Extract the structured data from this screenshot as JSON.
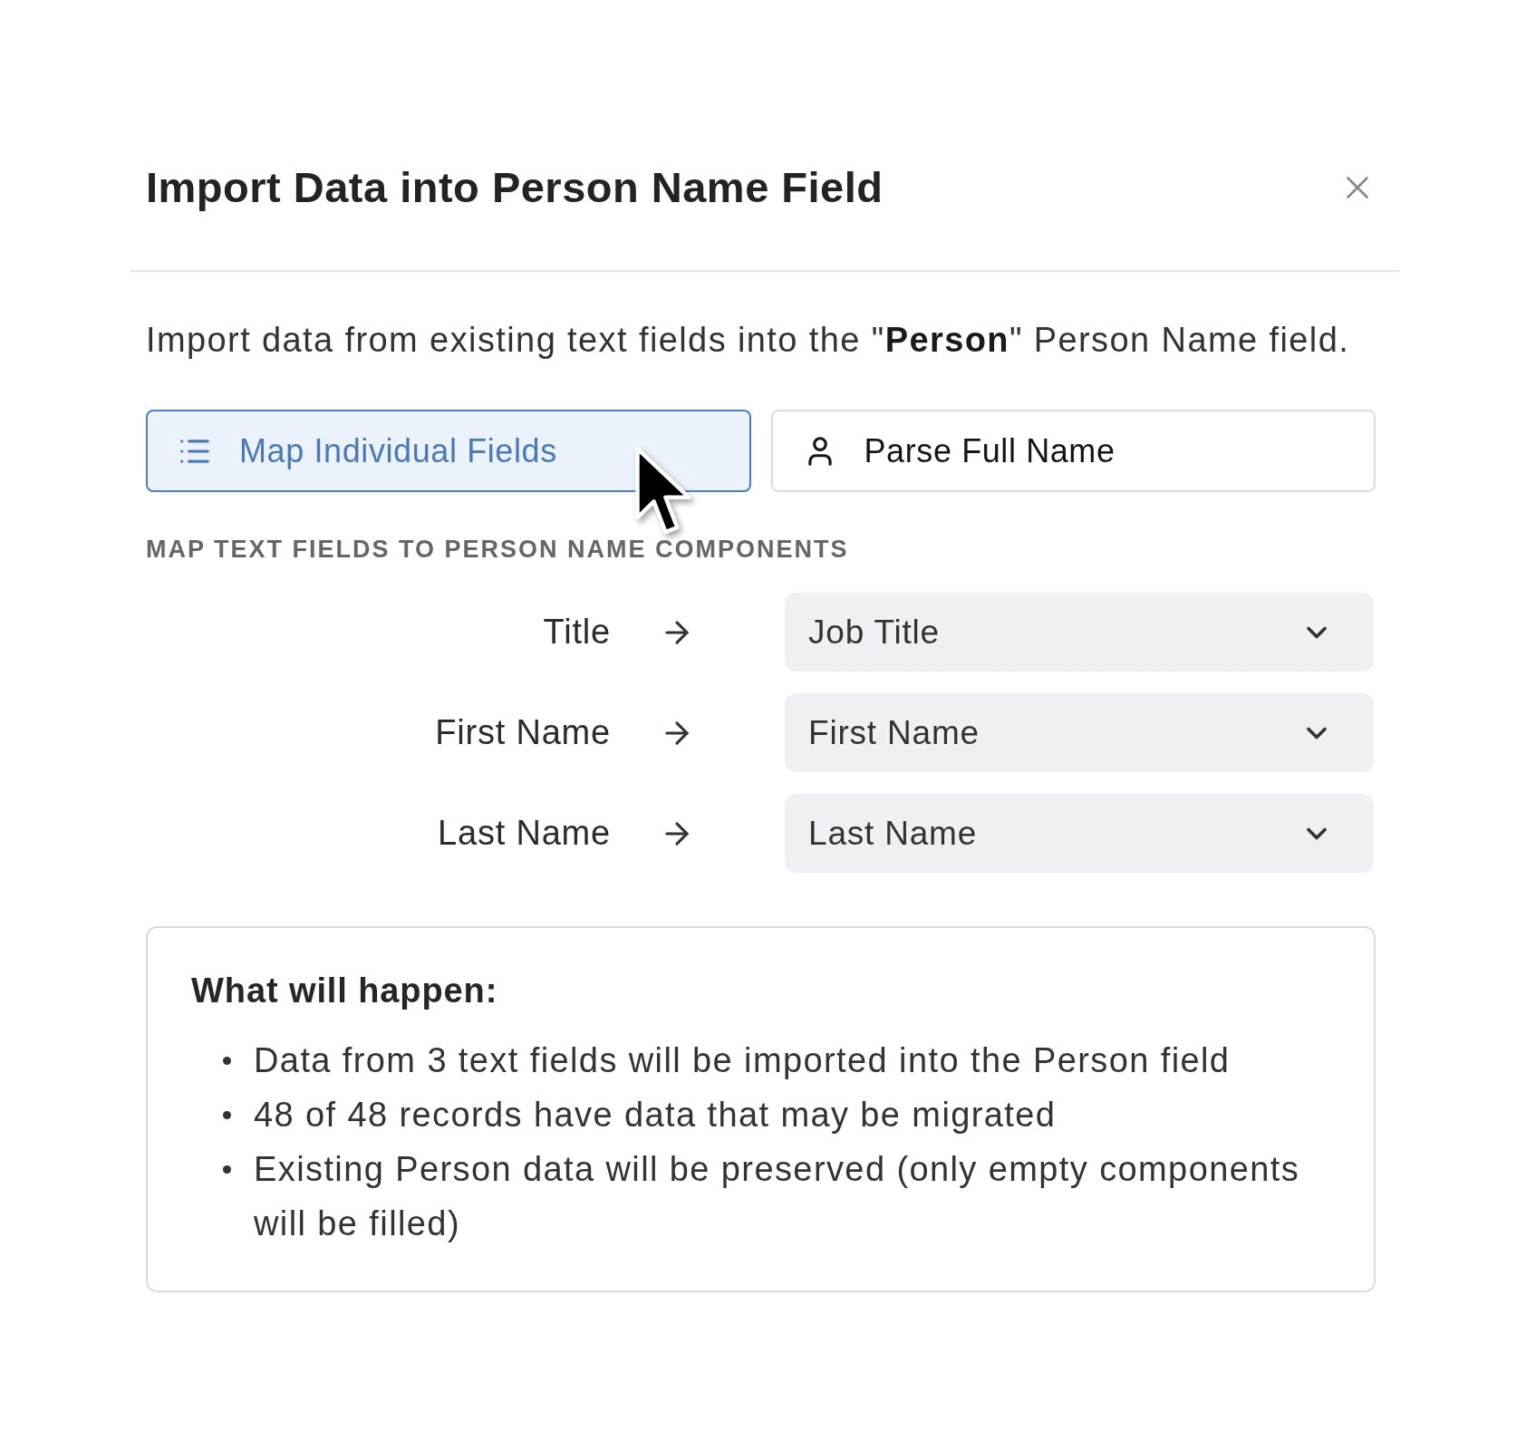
{
  "dialog": {
    "title": "Import Data into Person Name Field"
  },
  "description": "Import data from existing text fields into the \"**Person**\" Person Name field.",
  "mode_buttons": [
    {
      "label": "Map Individual Fields",
      "selected": true
    },
    {
      "label": "Parse Full Name",
      "selected": false
    }
  ],
  "section_label": "MAP TEXT FIELDS TO PERSON NAME COMPONENTS",
  "mappings": [
    {
      "component": "Title",
      "field": "Job Title"
    },
    {
      "component": "First Name",
      "field": "First Name"
    },
    {
      "component": "Last Name",
      "field": "Last Name"
    }
  ],
  "summary": {
    "heading": "What will happen:",
    "items": [
      "Data from 3 text fields will be imported into the Person field",
      "48 of 48 records have data that may be migrated",
      "Existing Person data will be preserved (only empty components will be filled)"
    ]
  }
}
